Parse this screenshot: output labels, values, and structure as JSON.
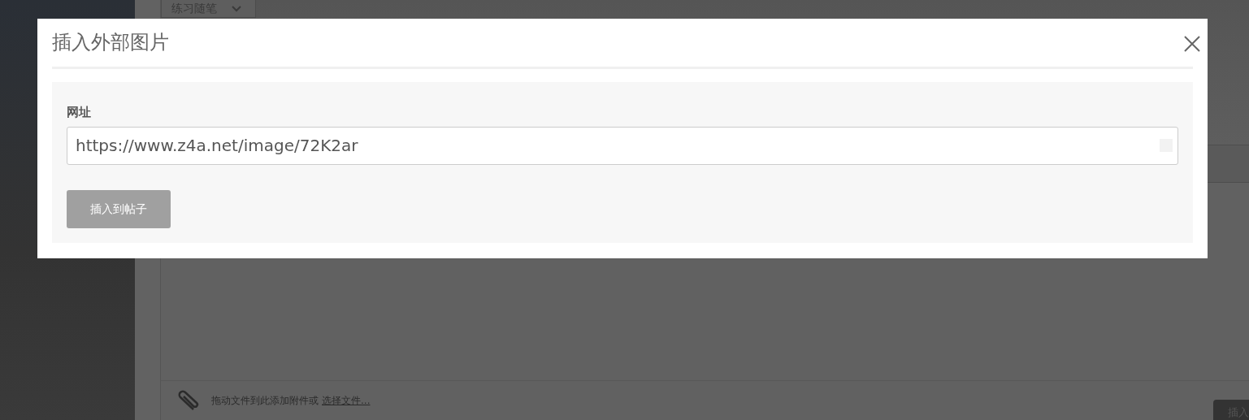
{
  "background": {
    "category_select": {
      "value": "练习随笔"
    },
    "attachment_bar": {
      "hint": "拖动文件到此添加附件或",
      "link": "选择文件..."
    },
    "submit_button": {
      "label": "插入"
    }
  },
  "dialog": {
    "title": "插入外部图片",
    "field": {
      "label": "网址",
      "value": "https://www.z4a.net/image/72K2ar"
    },
    "button": {
      "label": "插入到帖子",
      "disabled": true
    }
  }
}
